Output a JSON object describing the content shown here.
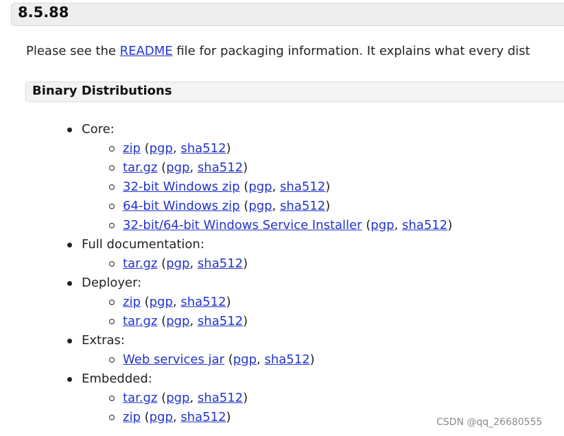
{
  "version": {
    "title": "8.5.88"
  },
  "intro": {
    "before": "Please see the ",
    "link": "README",
    "after": " file for packaging information. It explains what every dist"
  },
  "section": {
    "title": "Binary Distributions"
  },
  "groups": [
    {
      "label": "Core:",
      "items": [
        {
          "main": "zip",
          "pgp": "pgp",
          "sha": "sha512"
        },
        {
          "main": "tar.gz",
          "pgp": "pgp",
          "sha": "sha512"
        },
        {
          "main": "32-bit Windows zip",
          "pgp": "pgp",
          "sha": "sha512"
        },
        {
          "main": "64-bit Windows zip",
          "pgp": "pgp",
          "sha": "sha512"
        },
        {
          "main": "32-bit/64-bit Windows Service Installer",
          "pgp": "pgp",
          "sha": "sha512"
        }
      ]
    },
    {
      "label": "Full documentation:",
      "items": [
        {
          "main": "tar.gz",
          "pgp": "pgp",
          "sha": "sha512"
        }
      ]
    },
    {
      "label": "Deployer:",
      "items": [
        {
          "main": "zip",
          "pgp": "pgp",
          "sha": "sha512"
        },
        {
          "main": "tar.gz",
          "pgp": "pgp",
          "sha": "sha512"
        }
      ]
    },
    {
      "label": "Extras:",
      "items": [
        {
          "main": "Web services jar",
          "pgp": "pgp",
          "sha": "sha512"
        }
      ]
    },
    {
      "label": "Embedded:",
      "items": [
        {
          "main": "tar.gz",
          "pgp": "pgp",
          "sha": "sha512"
        },
        {
          "main": "zip",
          "pgp": "pgp",
          "sha": "sha512"
        }
      ]
    }
  ],
  "punct": {
    "open": " (",
    "comma": ", ",
    "close": ")"
  },
  "watermark": "CSDN @qq_26680555"
}
